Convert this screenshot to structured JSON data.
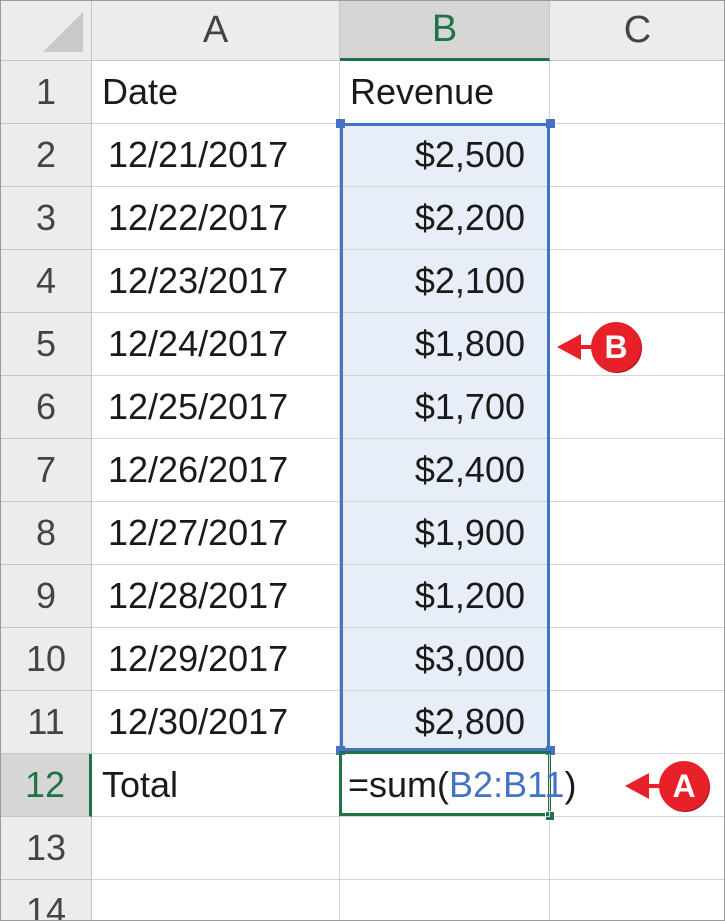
{
  "columns": [
    "A",
    "B",
    "C"
  ],
  "active_column": "B",
  "rows": [
    {
      "num": "1",
      "a": "Date",
      "b": "Revenue"
    },
    {
      "num": "2",
      "a": "12/21/2017",
      "b": "$2,500"
    },
    {
      "num": "3",
      "a": "12/22/2017",
      "b": "$2,200"
    },
    {
      "num": "4",
      "a": "12/23/2017",
      "b": "$2,100"
    },
    {
      "num": "5",
      "a": "12/24/2017",
      "b": "$1,800"
    },
    {
      "num": "6",
      "a": "12/25/2017",
      "b": "$1,700"
    },
    {
      "num": "7",
      "a": "12/26/2017",
      "b": "$2,400"
    },
    {
      "num": "8",
      "a": "12/27/2017",
      "b": "$1,900"
    },
    {
      "num": "9",
      "a": "12/28/2017",
      "b": "$1,200"
    },
    {
      "num": "10",
      "a": "12/29/2017",
      "b": "$3,000"
    },
    {
      "num": "11",
      "a": "12/30/2017",
      "b": "$2,800"
    },
    {
      "num": "12",
      "a": "Total",
      "b": ""
    },
    {
      "num": "13",
      "a": "",
      "b": ""
    },
    {
      "num": "14",
      "a": "",
      "b": ""
    }
  ],
  "formula": {
    "prefix": "=sum(",
    "ref": "B2:B11",
    "suffix": ")"
  },
  "callouts": {
    "a": "A",
    "b": "B"
  },
  "colors": {
    "accent_green": "#217346",
    "range_blue": "#4472c4",
    "callout_red": "#e8202a"
  }
}
